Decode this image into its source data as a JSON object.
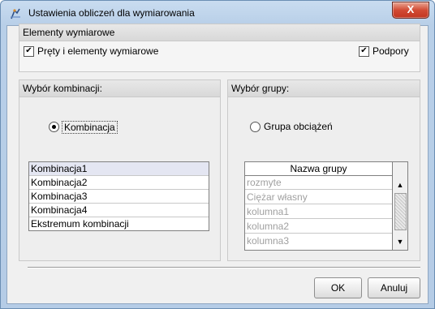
{
  "window": {
    "title": "Ustawienia obliczeń dla wymiarowania",
    "close_label": "X",
    "app_icon": "robot-structure-icon"
  },
  "elements_panel": {
    "header": "Elementy wymiarowe",
    "bars_checkbox": {
      "label": "Pręty i elementy wymiarowe",
      "checked": true
    },
    "supports_checkbox": {
      "label": "Podpory",
      "checked": true
    }
  },
  "combinations_panel": {
    "header": "Wybór kombinacji:",
    "radio": {
      "label": "Kombinacja",
      "selected": true
    },
    "items": [
      "Kombinacja1",
      "Kombinacja2",
      "Kombinacja3",
      "Kombinacja4",
      "Ekstremum kombinacji"
    ]
  },
  "groups_panel": {
    "header": "Wybór grupy:",
    "radio": {
      "label": "Grupa obciążeń",
      "selected": false
    },
    "table_header": "Nazwa grupy",
    "rows": [
      "rozmyte",
      "Ciężar własny",
      "kolumna1",
      "kolumna2",
      "kolumna3"
    ]
  },
  "buttons": {
    "ok": "OK",
    "cancel": "Anuluj"
  },
  "colors": {
    "title_bar": "#c9dcf0",
    "close_button": "#c23520",
    "disabled_text": "#a0a0a0"
  }
}
